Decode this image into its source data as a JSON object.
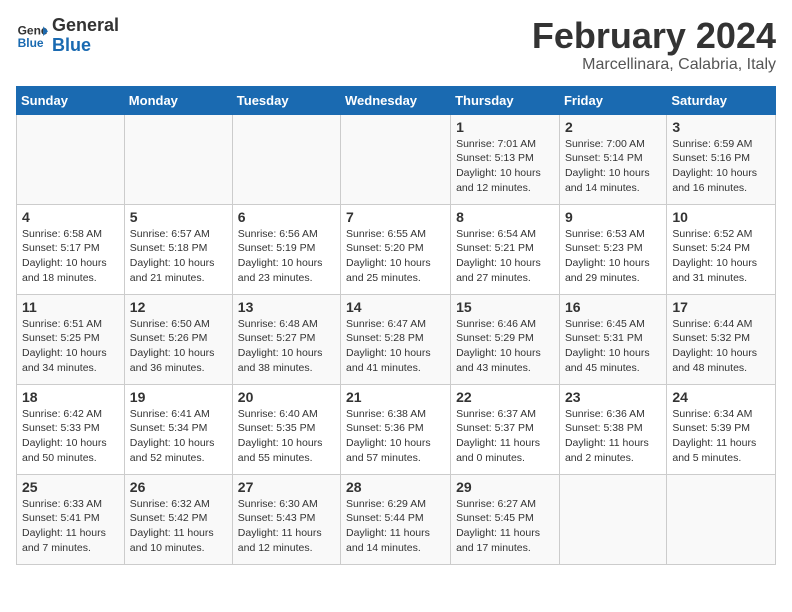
{
  "logo": {
    "line1": "General",
    "line2": "Blue"
  },
  "title": "February 2024",
  "subtitle": "Marcellinara, Calabria, Italy",
  "weekdays": [
    "Sunday",
    "Monday",
    "Tuesday",
    "Wednesday",
    "Thursday",
    "Friday",
    "Saturday"
  ],
  "weeks": [
    [
      {
        "day": "",
        "info": ""
      },
      {
        "day": "",
        "info": ""
      },
      {
        "day": "",
        "info": ""
      },
      {
        "day": "",
        "info": ""
      },
      {
        "day": "1",
        "info": "Sunrise: 7:01 AM\nSunset: 5:13 PM\nDaylight: 10 hours\nand 12 minutes."
      },
      {
        "day": "2",
        "info": "Sunrise: 7:00 AM\nSunset: 5:14 PM\nDaylight: 10 hours\nand 14 minutes."
      },
      {
        "day": "3",
        "info": "Sunrise: 6:59 AM\nSunset: 5:16 PM\nDaylight: 10 hours\nand 16 minutes."
      }
    ],
    [
      {
        "day": "4",
        "info": "Sunrise: 6:58 AM\nSunset: 5:17 PM\nDaylight: 10 hours\nand 18 minutes."
      },
      {
        "day": "5",
        "info": "Sunrise: 6:57 AM\nSunset: 5:18 PM\nDaylight: 10 hours\nand 21 minutes."
      },
      {
        "day": "6",
        "info": "Sunrise: 6:56 AM\nSunset: 5:19 PM\nDaylight: 10 hours\nand 23 minutes."
      },
      {
        "day": "7",
        "info": "Sunrise: 6:55 AM\nSunset: 5:20 PM\nDaylight: 10 hours\nand 25 minutes."
      },
      {
        "day": "8",
        "info": "Sunrise: 6:54 AM\nSunset: 5:21 PM\nDaylight: 10 hours\nand 27 minutes."
      },
      {
        "day": "9",
        "info": "Sunrise: 6:53 AM\nSunset: 5:23 PM\nDaylight: 10 hours\nand 29 minutes."
      },
      {
        "day": "10",
        "info": "Sunrise: 6:52 AM\nSunset: 5:24 PM\nDaylight: 10 hours\nand 31 minutes."
      }
    ],
    [
      {
        "day": "11",
        "info": "Sunrise: 6:51 AM\nSunset: 5:25 PM\nDaylight: 10 hours\nand 34 minutes."
      },
      {
        "day": "12",
        "info": "Sunrise: 6:50 AM\nSunset: 5:26 PM\nDaylight: 10 hours\nand 36 minutes."
      },
      {
        "day": "13",
        "info": "Sunrise: 6:48 AM\nSunset: 5:27 PM\nDaylight: 10 hours\nand 38 minutes."
      },
      {
        "day": "14",
        "info": "Sunrise: 6:47 AM\nSunset: 5:28 PM\nDaylight: 10 hours\nand 41 minutes."
      },
      {
        "day": "15",
        "info": "Sunrise: 6:46 AM\nSunset: 5:29 PM\nDaylight: 10 hours\nand 43 minutes."
      },
      {
        "day": "16",
        "info": "Sunrise: 6:45 AM\nSunset: 5:31 PM\nDaylight: 10 hours\nand 45 minutes."
      },
      {
        "day": "17",
        "info": "Sunrise: 6:44 AM\nSunset: 5:32 PM\nDaylight: 10 hours\nand 48 minutes."
      }
    ],
    [
      {
        "day": "18",
        "info": "Sunrise: 6:42 AM\nSunset: 5:33 PM\nDaylight: 10 hours\nand 50 minutes."
      },
      {
        "day": "19",
        "info": "Sunrise: 6:41 AM\nSunset: 5:34 PM\nDaylight: 10 hours\nand 52 minutes."
      },
      {
        "day": "20",
        "info": "Sunrise: 6:40 AM\nSunset: 5:35 PM\nDaylight: 10 hours\nand 55 minutes."
      },
      {
        "day": "21",
        "info": "Sunrise: 6:38 AM\nSunset: 5:36 PM\nDaylight: 10 hours\nand 57 minutes."
      },
      {
        "day": "22",
        "info": "Sunrise: 6:37 AM\nSunset: 5:37 PM\nDaylight: 11 hours\nand 0 minutes."
      },
      {
        "day": "23",
        "info": "Sunrise: 6:36 AM\nSunset: 5:38 PM\nDaylight: 11 hours\nand 2 minutes."
      },
      {
        "day": "24",
        "info": "Sunrise: 6:34 AM\nSunset: 5:39 PM\nDaylight: 11 hours\nand 5 minutes."
      }
    ],
    [
      {
        "day": "25",
        "info": "Sunrise: 6:33 AM\nSunset: 5:41 PM\nDaylight: 11 hours\nand 7 minutes."
      },
      {
        "day": "26",
        "info": "Sunrise: 6:32 AM\nSunset: 5:42 PM\nDaylight: 11 hours\nand 10 minutes."
      },
      {
        "day": "27",
        "info": "Sunrise: 6:30 AM\nSunset: 5:43 PM\nDaylight: 11 hours\nand 12 minutes."
      },
      {
        "day": "28",
        "info": "Sunrise: 6:29 AM\nSunset: 5:44 PM\nDaylight: 11 hours\nand 14 minutes."
      },
      {
        "day": "29",
        "info": "Sunrise: 6:27 AM\nSunset: 5:45 PM\nDaylight: 11 hours\nand 17 minutes."
      },
      {
        "day": "",
        "info": ""
      },
      {
        "day": "",
        "info": ""
      }
    ]
  ]
}
